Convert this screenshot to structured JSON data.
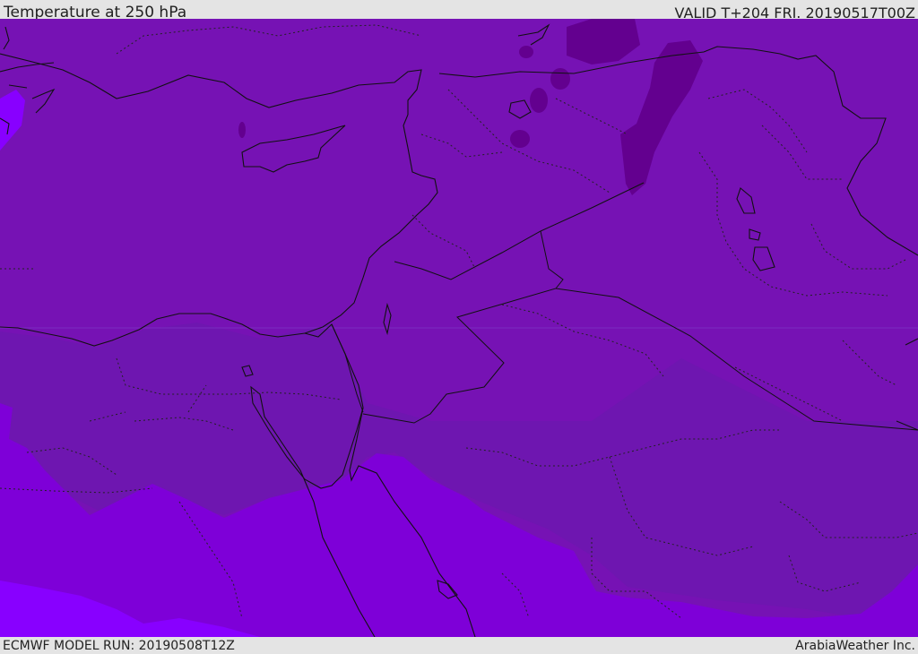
{
  "header": {
    "title": "Temperature at 250 hPa",
    "valid": "VALID T+204 FRI. 20190517T00Z"
  },
  "footer": {
    "model_run": "ECMWF MODEL RUN: 20190508T12Z",
    "credit": "ArabiaWeather Inc."
  },
  "map": {
    "region": "Eastern Mediterranean, Levant, Egypt, Iraq, northern Saudi Arabia",
    "colors": {
      "field_main": "#7612b4",
      "field_south": "#6c18b2",
      "field_warm": "#7e00d8",
      "field_warmest": "#8800ff",
      "field_cold": "#63008f",
      "coastline": "#111111",
      "borders_dotted": "#222222"
    }
  }
}
